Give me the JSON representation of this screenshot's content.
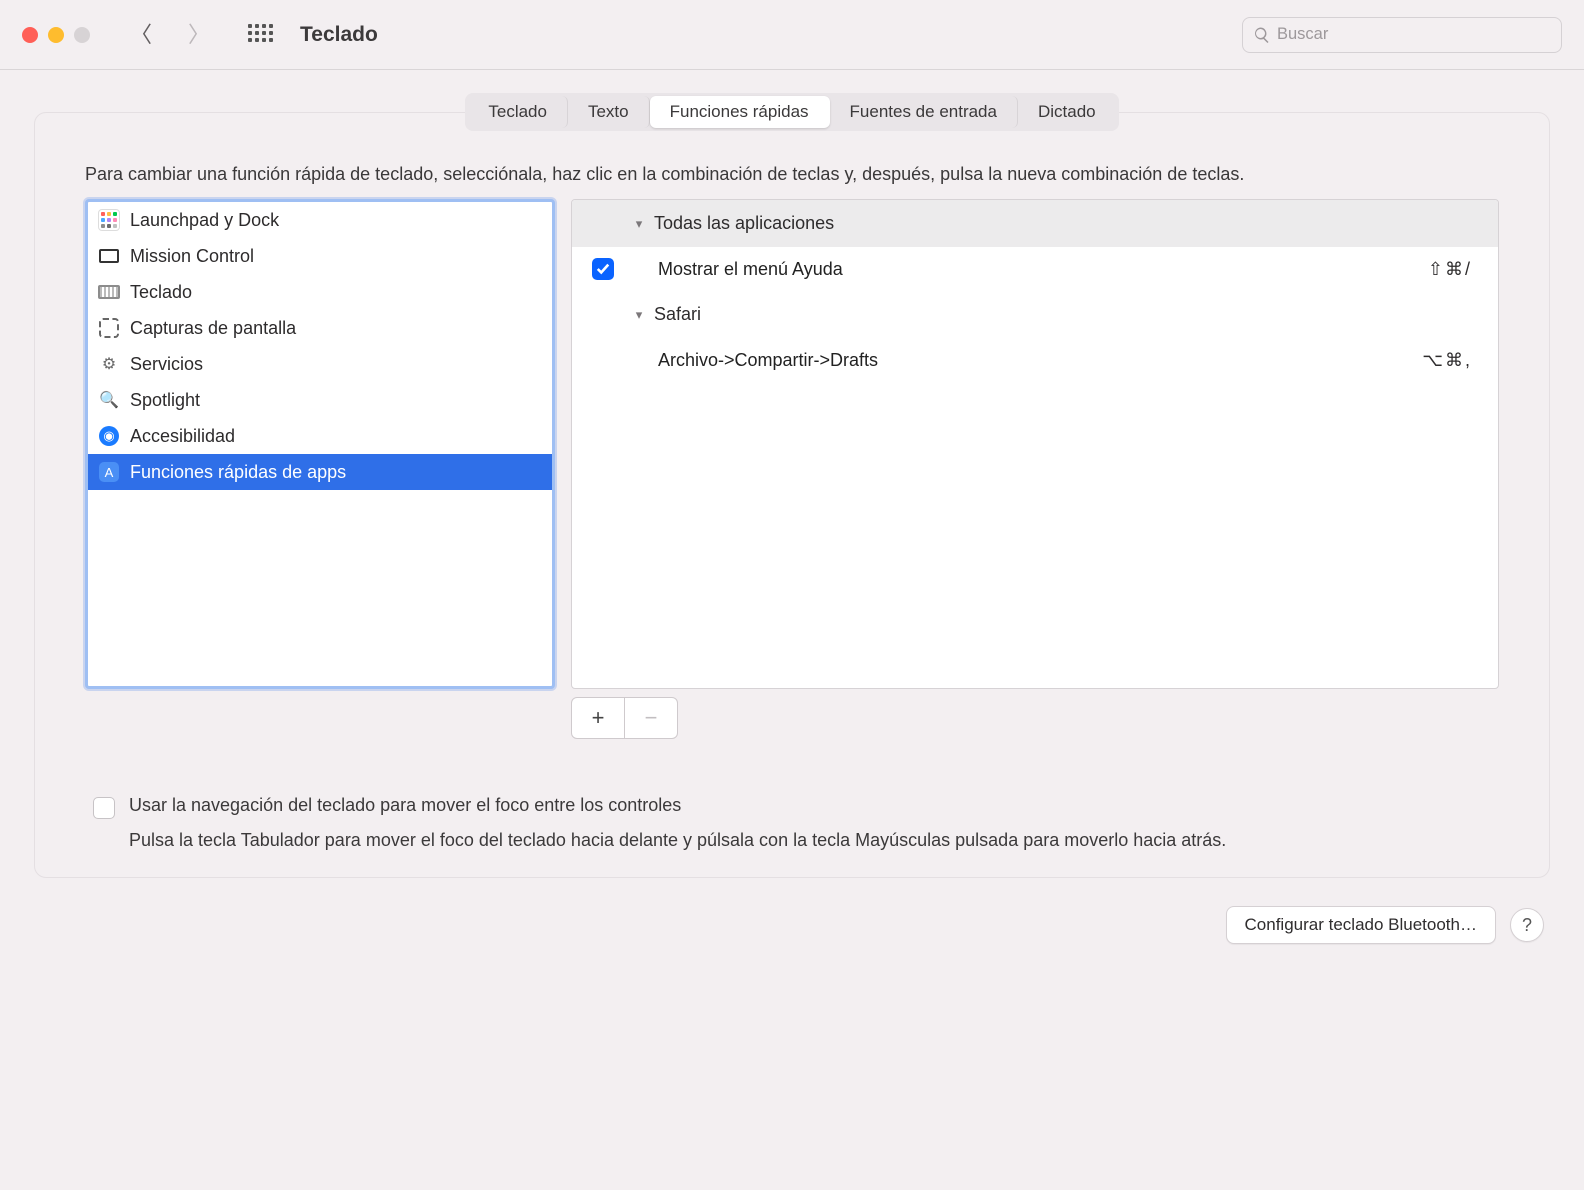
{
  "window": {
    "title": "Teclado",
    "search_placeholder": "Buscar"
  },
  "tabs": [
    {
      "label": "Teclado",
      "active": false
    },
    {
      "label": "Texto",
      "active": false
    },
    {
      "label": "Funciones rápidas",
      "active": true
    },
    {
      "label": "Fuentes de entrada",
      "active": false
    },
    {
      "label": "Dictado",
      "active": false
    }
  ],
  "instructions": "Para cambiar una función rápida de teclado, selecciónala, haz clic en la combinación de teclas y, después, pulsa la nueva combinación de teclas.",
  "categories": [
    {
      "label": "Launchpad y Dock",
      "icon": "launchpad-icon"
    },
    {
      "label": "Mission Control",
      "icon": "mission-control-icon"
    },
    {
      "label": "Teclado",
      "icon": "keyboard-icon"
    },
    {
      "label": "Capturas de pantalla",
      "icon": "screenshot-icon"
    },
    {
      "label": "Servicios",
      "icon": "gear-icon"
    },
    {
      "label": "Spotlight",
      "icon": "magnifier-icon"
    },
    {
      "label": "Accesibilidad",
      "icon": "accessibility-icon"
    },
    {
      "label": "Funciones rápidas de apps",
      "icon": "appstore-icon",
      "selected": true
    }
  ],
  "shortcuts": {
    "groups": [
      {
        "title": "Todas las aplicaciones",
        "items": [
          {
            "checked": true,
            "label": "Mostrar el menú Ayuda",
            "keys": "⇧⌘/"
          }
        ]
      },
      {
        "title": "Safari",
        "items": [
          {
            "checked": false,
            "label": "Archivo->Compartir->Drafts",
            "keys": "⌥⌘,"
          }
        ]
      }
    ]
  },
  "buttons": {
    "add": "+",
    "remove": "−"
  },
  "keyboard_nav": {
    "checkbox_label": "Usar la navegación del teclado para mover el foco entre los controles",
    "description": "Pulsa la tecla Tabulador para mover el foco del teclado hacia delante y púlsala con la tecla Mayúsculas pulsada para moverlo hacia atrás."
  },
  "footer": {
    "bluetooth_button": "Configurar teclado Bluetooth…",
    "help": "?"
  }
}
